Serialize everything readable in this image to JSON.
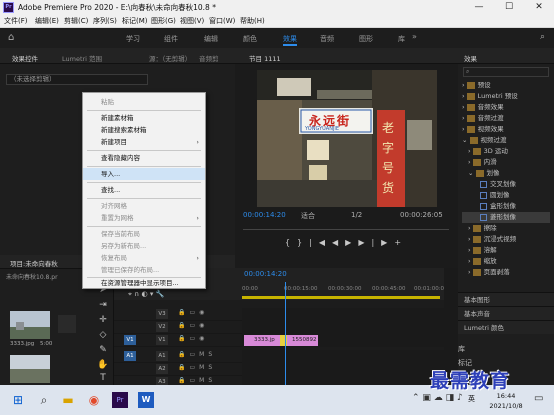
{
  "titlebar": {
    "title": "Adobe Premiere Pro 2020 - E:\\向春秋\\未命向春秋10.8 *",
    "app_icon": "Pr",
    "minimize": "—",
    "maximize": "☐",
    "close": "✕"
  },
  "menubar": {
    "items": [
      "文件(F)",
      "编辑(E)",
      "剪辑(C)",
      "序列(S)",
      "标记(M)",
      "图形(G)",
      "视图(V)",
      "窗口(W)",
      "帮助(H)"
    ]
  },
  "workspace": {
    "tabs": [
      "学习",
      "组件",
      "编辑",
      "颜色",
      "效果",
      "音频",
      "图形",
      "库"
    ],
    "active": "效果",
    "more": "»"
  },
  "effect_controls": {
    "tabs": [
      "效果控件",
      "Lumetri 范围",
      "源：（无剪辑）",
      "音频剪"
    ],
    "dropdown": "（未选择剪辑）"
  },
  "program": {
    "tab": "节目 1111",
    "timecode": "00:00:14:20",
    "fit": "适合",
    "ratio": "1/2",
    "end_timecode": "00:00:26:05",
    "sign_main": "永远街",
    "sign_sub": "YONGYUANJIE",
    "controls": [
      "{",
      "}",
      "|◀",
      "◀",
      "▶",
      "▶|",
      "▶",
      "+"
    ]
  },
  "effects": {
    "tab": "效果",
    "search_placeholder": "",
    "items": [
      {
        "label": "预设",
        "type": "folder"
      },
      {
        "label": "Lumetri 预设",
        "type": "folder"
      },
      {
        "label": "音频效果",
        "type": "folder"
      },
      {
        "label": "音频过渡",
        "type": "folder"
      },
      {
        "label": "视频效果",
        "type": "folder"
      },
      {
        "label": "视频过渡",
        "type": "folder"
      },
      {
        "label": "3D 运动",
        "type": "folder"
      },
      {
        "label": "内滑",
        "type": "folder"
      },
      {
        "label": "划像",
        "type": "folder"
      },
      {
        "label": "擦除",
        "type": "folder"
      },
      {
        "label": "交叉划像",
        "type": "effect"
      },
      {
        "label": "圆划像",
        "type": "effect"
      },
      {
        "label": "盒形划像",
        "type": "effect"
      },
      {
        "label": "菱形划像",
        "type": "effect"
      },
      {
        "label": "擦除",
        "type": "folder"
      },
      {
        "label": "沉浸式视频",
        "type": "folder"
      },
      {
        "label": "溶解",
        "type": "folder"
      },
      {
        "label": "缩放",
        "type": "folder"
      },
      {
        "label": "页面剥落",
        "type": "folder"
      }
    ],
    "bottom": [
      "基本图形",
      "基本声音",
      "Lumetri 颜色",
      "库",
      "标记"
    ]
  },
  "context_menu": {
    "items": [
      {
        "label": "粘贴",
        "disabled": true
      },
      {
        "label": "新建素材箱",
        "disabled": false
      },
      {
        "label": "新建搜索素材箱",
        "disabled": false
      },
      {
        "label": "新建项目",
        "disabled": false,
        "submenu": true
      },
      {
        "label": "查看隐藏内容",
        "disabled": false
      },
      {
        "label": "导入...",
        "disabled": false,
        "highlight": true
      },
      {
        "label": "查找...",
        "disabled": false
      },
      {
        "label": "对齐网格",
        "disabled": true
      },
      {
        "label": "重置为网格",
        "disabled": true,
        "submenu": true
      },
      {
        "label": "保存当前布局",
        "disabled": true
      },
      {
        "label": "另存为新布局...",
        "disabled": true
      },
      {
        "label": "恢复布局",
        "disabled": true,
        "submenu": true
      },
      {
        "label": "管理已保存的布局...",
        "disabled": true
      },
      {
        "label": "在资源管理器中显示项目...",
        "disabled": false
      }
    ]
  },
  "project": {
    "tab": "项目:未命向春秋",
    "subtitle": "未命向春秋10.8.pr",
    "clip_label": "3333.jpg",
    "clip_duration": "5:00"
  },
  "timeline": {
    "timecode": "00:00:14:20",
    "ruler": [
      "00:00",
      "00:00:15:00",
      "00:00:30:00",
      "00:00:45:00",
      "00:01:00:0"
    ],
    "tracks": [
      {
        "name": "V3",
        "type": "video"
      },
      {
        "name": "V2",
        "type": "video"
      },
      {
        "name": "V1",
        "type": "video",
        "source": "V1"
      },
      {
        "name": "A1",
        "type": "audio",
        "source": "A1"
      },
      {
        "name": "A2",
        "type": "audio"
      },
      {
        "name": "A3",
        "type": "audio"
      }
    ],
    "clips": [
      "3333.jp",
      "1550892"
    ]
  },
  "taskbar": {
    "time": "16:44",
    "date": "2021/10/8",
    "lang": "英"
  },
  "watermark": "最需教育",
  "colors": {
    "accent": "#2d8ceb",
    "clip": "#d88ad8",
    "menu_highlight": "#cfe3f6"
  }
}
